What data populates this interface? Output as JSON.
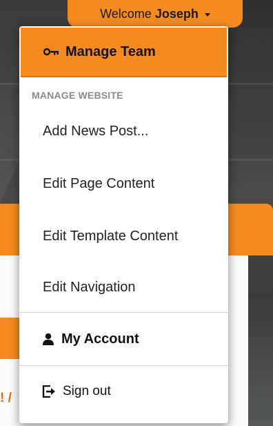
{
  "header": {
    "welcome_prefix": "Welcome",
    "user_name": "Joseph"
  },
  "menu": {
    "manage_team_label": "Manage Team",
    "section_header": "MANAGE WEBSITE",
    "items": [
      {
        "label": "Add News Post..."
      },
      {
        "label": "Edit Page Content"
      },
      {
        "label": "Edit Template Content"
      },
      {
        "label": "Edit Navigation"
      }
    ],
    "my_account_label": "My Account",
    "sign_out_label": "Sign out"
  },
  "background": {
    "fragment_text": "! /"
  },
  "colors": {
    "accent": "#f58a1f",
    "menu_bg": "#ffffff",
    "section_header": "#8a8a8a"
  },
  "icons": {
    "manage_team": "key-icon",
    "my_account": "user-icon",
    "sign_out": "sign-out-icon",
    "dropdown": "caret-down-icon"
  }
}
